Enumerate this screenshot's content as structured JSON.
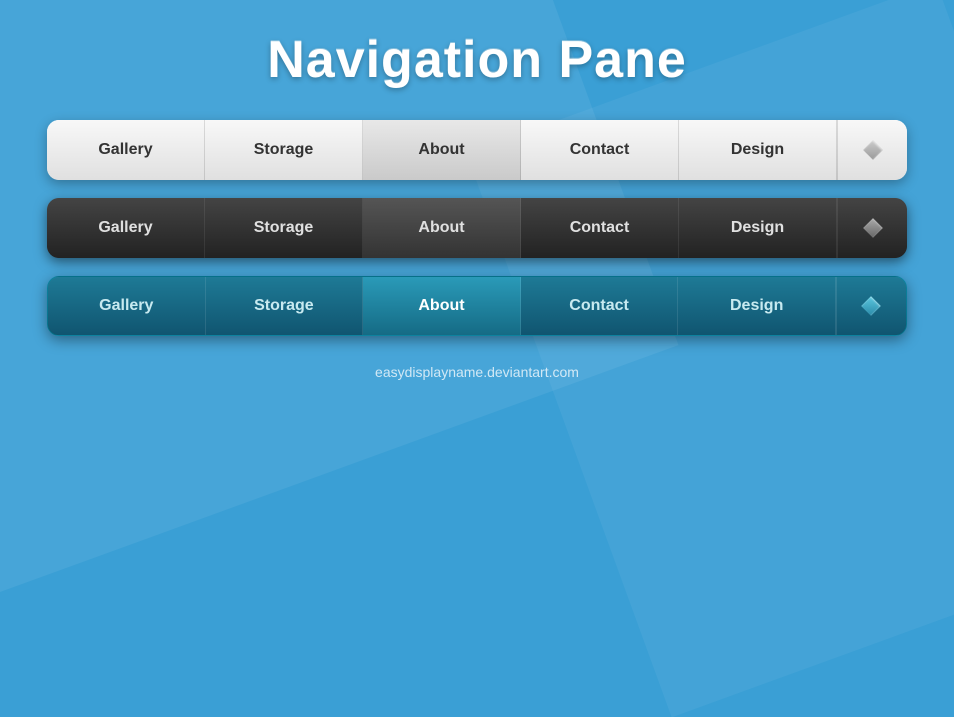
{
  "page": {
    "title": "Navigation Pane",
    "footer": "easydisplayname.deviantart.com"
  },
  "navbars": [
    {
      "id": "white",
      "theme": "white",
      "items": [
        {
          "label": "Gallery",
          "active": false
        },
        {
          "label": "Storage",
          "active": false
        },
        {
          "label": "About",
          "active": true
        },
        {
          "label": "Contact",
          "active": false
        },
        {
          "label": "Design",
          "active": false
        }
      ]
    },
    {
      "id": "dark",
      "theme": "dark",
      "items": [
        {
          "label": "Gallery",
          "active": false
        },
        {
          "label": "Storage",
          "active": false
        },
        {
          "label": "About",
          "active": true
        },
        {
          "label": "Contact",
          "active": false
        },
        {
          "label": "Design",
          "active": false
        }
      ]
    },
    {
      "id": "teal",
      "theme": "teal",
      "items": [
        {
          "label": "Gallery",
          "active": false
        },
        {
          "label": "Storage",
          "active": false
        },
        {
          "label": "About",
          "active": true
        },
        {
          "label": "Contact",
          "active": false
        },
        {
          "label": "Design",
          "active": false
        }
      ]
    }
  ]
}
